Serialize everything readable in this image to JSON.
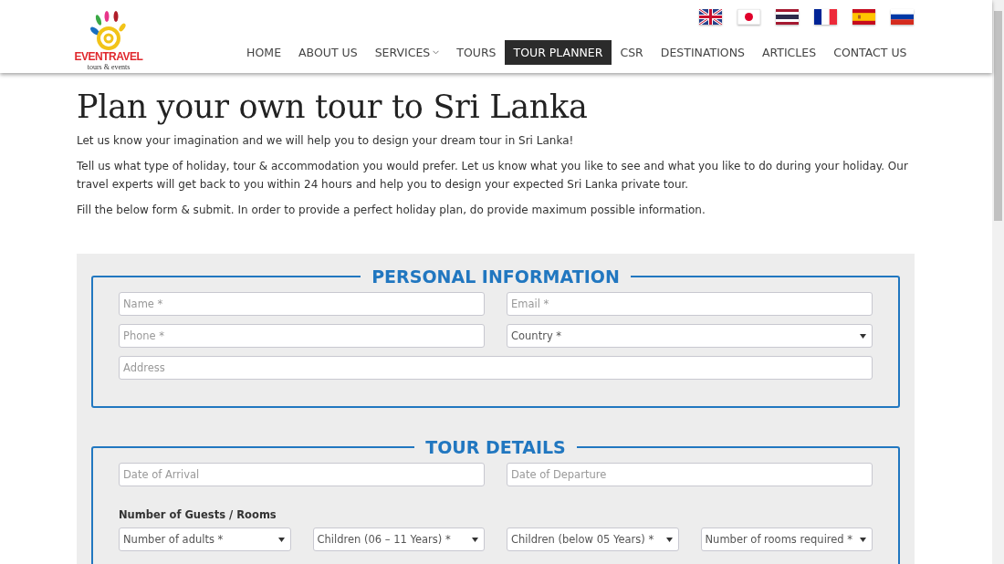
{
  "logo": {
    "name": "EVENTRAVEL",
    "tagline": "tours & events"
  },
  "languages": [
    {
      "kind": "uk"
    },
    {
      "kind": "jp"
    },
    {
      "kind": "th"
    },
    {
      "kind": "fr"
    },
    {
      "kind": "es"
    },
    {
      "kind": "ru"
    }
  ],
  "nav": [
    {
      "label": "HOME",
      "selected": false,
      "dropdown": false
    },
    {
      "label": "ABOUT US",
      "selected": false,
      "dropdown": false
    },
    {
      "label": "SERVICES",
      "selected": false,
      "dropdown": true
    },
    {
      "label": "TOURS",
      "selected": false,
      "dropdown": false
    },
    {
      "label": "TOUR PLANNER",
      "selected": true,
      "dropdown": false
    },
    {
      "label": "CSR",
      "selected": false,
      "dropdown": false
    },
    {
      "label": "DESTINATIONS",
      "selected": false,
      "dropdown": false
    },
    {
      "label": "ARTICLES",
      "selected": false,
      "dropdown": false
    },
    {
      "label": "CONTACT US",
      "selected": false,
      "dropdown": false
    }
  ],
  "heading": "Plan your own tour to Sri Lanka",
  "paragraphs": [
    "Let  us know your imagination and we will help you to design your dream tour in Sri Lanka!",
    "Tell us what type of holiday, tour & accommodation you would prefer. Let us know what you like to see and what you like to do during your holiday. Our travel experts will get back to you within 24 hours and help you to design your expected Sri Lanka private tour.",
    "Fill the below form & submit. In order to provide a perfect holiday plan, do provide maximum possible information."
  ],
  "sections": [
    {
      "legend": "PERSONAL INFORMATION",
      "rows": [
        {
          "fields": [
            {
              "kind": "input",
              "placeholder": "Name *"
            },
            {
              "kind": "input",
              "placeholder": "Email *"
            }
          ]
        },
        {
          "fields": [
            {
              "kind": "input",
              "placeholder": "Phone *"
            },
            {
              "kind": "select",
              "value": "Country *"
            }
          ]
        },
        {
          "fields": [
            {
              "kind": "input",
              "placeholder": "Address"
            }
          ]
        }
      ]
    },
    {
      "legend": "TOUR DETAILS",
      "rows": [
        {
          "fields": [
            {
              "kind": "input",
              "placeholder": "Date of Arrival"
            },
            {
              "kind": "input",
              "placeholder": "Date of Departure"
            }
          ]
        },
        {
          "label": "Number of Guests / Rooms",
          "fields": [
            {
              "kind": "select",
              "value": "Number of adults *"
            },
            {
              "kind": "select",
              "value": "Children (06 – 11 Years) *"
            },
            {
              "kind": "select",
              "value": "Children (below 05 Years) *"
            },
            {
              "kind": "select",
              "value": "Number of rooms required *"
            }
          ]
        }
      ]
    }
  ]
}
